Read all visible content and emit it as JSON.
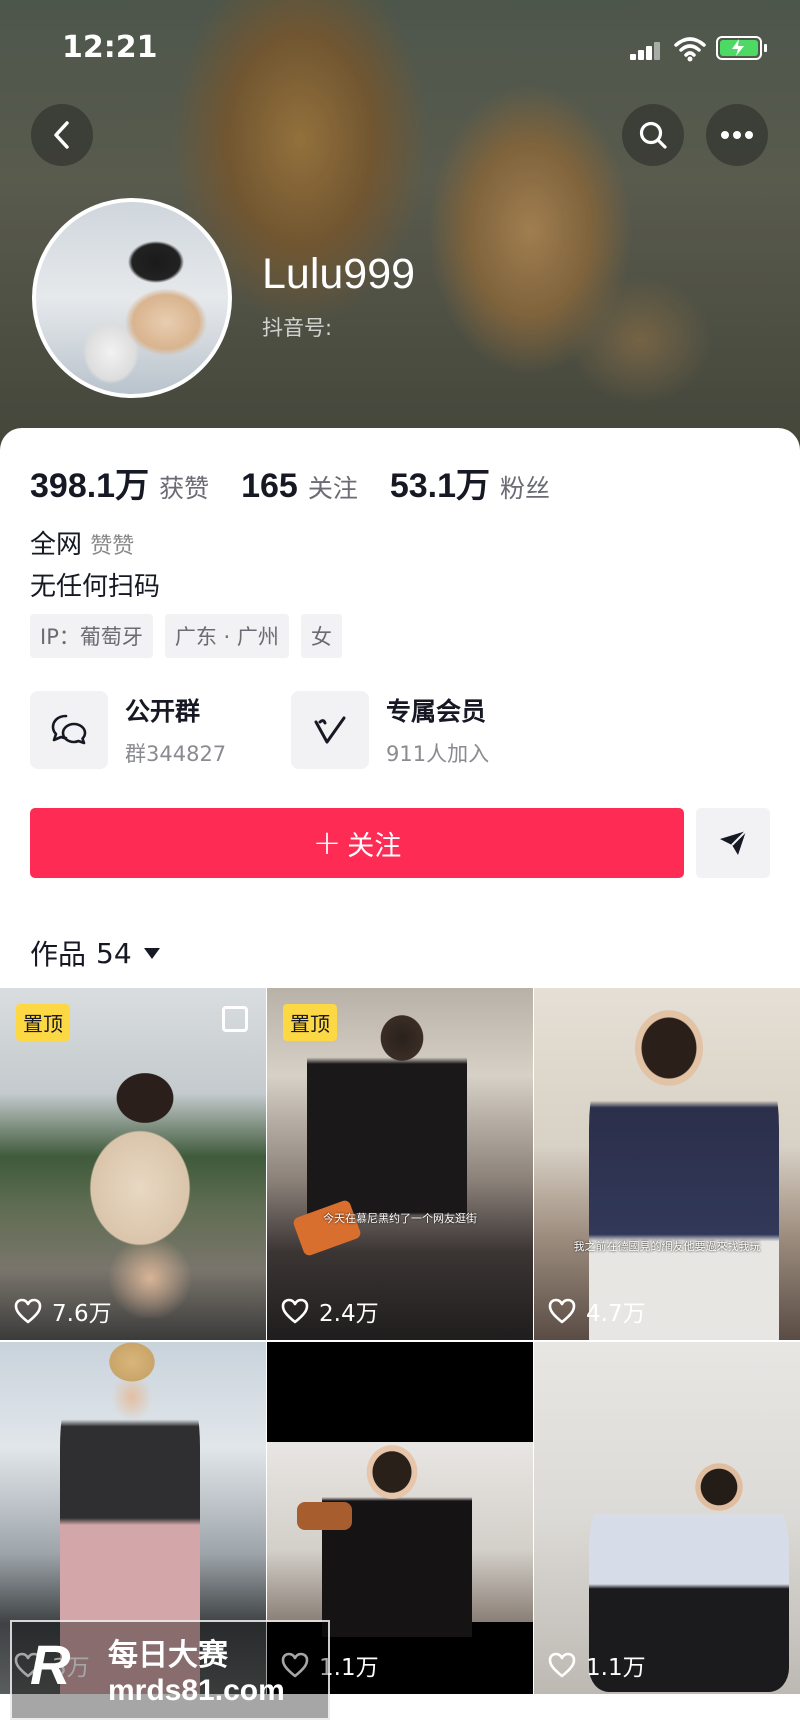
{
  "status_bar": {
    "time": "12:21"
  },
  "profile": {
    "nickname": "Lulu999",
    "douyin_id_label": "抖音号:"
  },
  "stats": [
    {
      "value": "398.1万",
      "label": "获赞"
    },
    {
      "value": "165",
      "label": "关注"
    },
    {
      "value": "53.1万",
      "label": "粉丝"
    }
  ],
  "bio": {
    "line1_prefix": "全网 ",
    "line1_faded": "赞赞",
    "line2": "无任何扫码"
  },
  "tags": [
    "IP：葡萄牙",
    "广东 · 广州",
    "女"
  ],
  "features": {
    "group": {
      "title": "公开群",
      "subtitle": "群344827"
    },
    "member": {
      "title": "专属会员",
      "subtitle": "911人加入"
    }
  },
  "actions": {
    "follow_label": "关注",
    "follow_plus": "+"
  },
  "works": {
    "label": "作品",
    "count": "54"
  },
  "videos": [
    {
      "pinned": true,
      "pin_label": "置顶",
      "likes": "7.6万",
      "subtitle": ""
    },
    {
      "pinned": true,
      "pin_label": "置顶",
      "likes": "2.4万",
      "subtitle": "今天在慕尼黑约了一个网友逛街"
    },
    {
      "pinned": false,
      "pin_label": "",
      "likes": "4.7万",
      "subtitle": "我之前在德國見的網友他要過來找我玩"
    },
    {
      "pinned": false,
      "pin_label": "",
      "likes": "3万",
      "subtitle": ""
    },
    {
      "pinned": false,
      "pin_label": "",
      "likes": "1.1万",
      "subtitle": ""
    },
    {
      "pinned": false,
      "pin_label": "",
      "likes": "1.1万",
      "subtitle": ""
    }
  ],
  "watermark": {
    "logo": "R",
    "title": "每日大赛",
    "url": "mrds81.com"
  },
  "colors": {
    "accent": "#fe2c55",
    "pin": "#fdd845",
    "battery": "#4cd964"
  }
}
